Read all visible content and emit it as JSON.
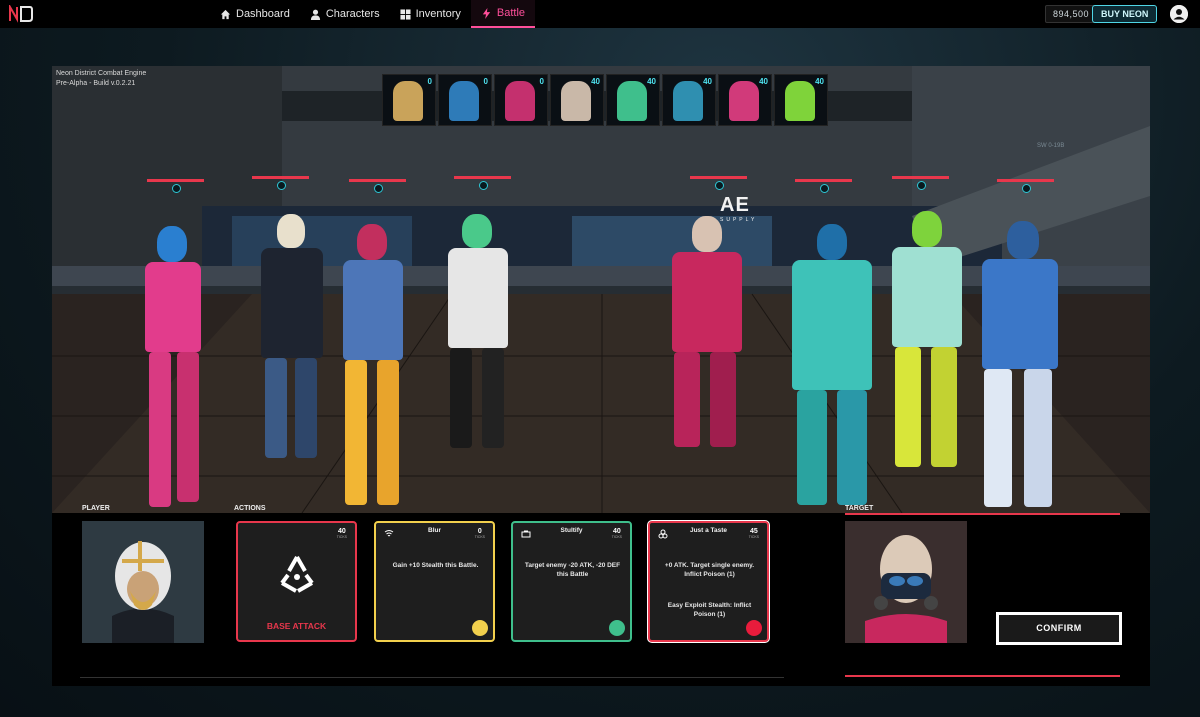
{
  "nav": {
    "items": [
      {
        "label": "Dashboard",
        "icon": "home-icon"
      },
      {
        "label": "Characters",
        "icon": "person-icon"
      },
      {
        "label": "Inventory",
        "icon": "grid-icon"
      },
      {
        "label": "Battle",
        "icon": "bolt-icon",
        "active": true
      }
    ],
    "balance": "894,500",
    "buy_label": "BUY NEON"
  },
  "battle": {
    "engine_title": "Neon District Combat Engine",
    "build": "Pre-Alpha - Build v.0.2.21",
    "turn_order": [
      {
        "value": "0",
        "color": "#c9a35a"
      },
      {
        "value": "0",
        "color": "#2e7bb8"
      },
      {
        "value": "0",
        "color": "#c4306e"
      },
      {
        "value": "40",
        "color": "#c9b8a8"
      },
      {
        "value": "40",
        "color": "#3fbf8c"
      },
      {
        "value": "40",
        "color": "#2f8fb0"
      },
      {
        "value": "40",
        "color": "#d13a7a"
      },
      {
        "value": "40",
        "color": "#7fd33a"
      }
    ],
    "sign_text": "AE",
    "sign_sub": "SUPPLY",
    "wall_text": "SW 0-19B"
  },
  "player": {
    "label": "PLAYER"
  },
  "actions": {
    "label": "ACTIONS",
    "cards": [
      {
        "title": "",
        "cost": "40",
        "cost_unit": "TICKS",
        "name": "BASE ATTACK",
        "desc": "",
        "desc2": "",
        "border": "#e8374c",
        "dot": ""
      },
      {
        "title": "Blur",
        "cost": "0",
        "cost_unit": "TICKS",
        "desc": "Gain +10 Stealth this Battle.",
        "desc2": "",
        "border": "#f2d04d",
        "dot": "#f2d04d"
      },
      {
        "title": "Stultify",
        "cost": "40",
        "cost_unit": "TICKS",
        "desc": "Target enemy -20 ATK, -20 DEF this Battle",
        "desc2": "",
        "border": "#3fbf8c",
        "dot": "#3fbf8c"
      },
      {
        "title": "Just a Taste",
        "cost": "45",
        "cost_unit": "TICKS",
        "desc": "+0 ATK. Target single enemy. Inflict Poison (1)",
        "desc2": "Easy Exploit Stealth: Inflict Poison (1)",
        "border": "#e8374c",
        "dot": "#e81c3c"
      }
    ]
  },
  "target": {
    "label": "TARGET",
    "confirm_label": "CONFIRM"
  },
  "colors": {
    "accent": "#ff4f9a",
    "hp": "#e8374c",
    "cyan": "#2dc8d6"
  }
}
